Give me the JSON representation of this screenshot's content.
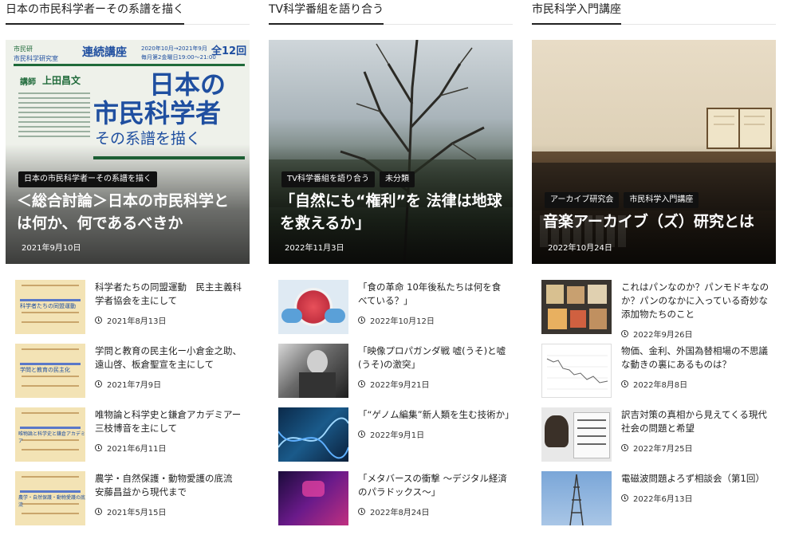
{
  "columns": [
    {
      "section_title": "日本の市民科学者ーその系譜を描く",
      "feature": {
        "tags": [
          "日本の市民科学者ーその系譜を描く"
        ],
        "title": "＜総合討論＞日本の市民科学とは何か、何であるべきか",
        "date": "2021年9月10日",
        "poster": {
          "org": "市民研",
          "lab": "市民科学研究室",
          "series": "連続講座",
          "period": "2020年10月→2021年9月",
          "total": "全12回",
          "schedule": "毎月第2金曜日19:00〜21:00",
          "lecturer_label": "講師",
          "lecturer": "上田昌文",
          "heading_1": "日本の",
          "heading_2": "市民科学者",
          "heading_3": "その系譜を描く"
        }
      },
      "items": [
        {
          "title": "科学者たちの同盟運動　民主主義科学者協会を主にして",
          "date": "2021年8月13日",
          "thumb_label": "科学者たちの同盟運動"
        },
        {
          "title": "学問と教育の民主化ー小倉金之助、遠山啓、板倉聖宣を主にして",
          "date": "2021年7月9日",
          "thumb_label": "学問と教育の民主化"
        },
        {
          "title": "唯物論と科学史と鎌倉アカデミアー三枝博音を主にして",
          "date": "2021年6月11日",
          "thumb_label": "唯物論と科学史と鎌倉アカデミア"
        },
        {
          "title": "農学・自然保護・動物愛護の底流　安藤昌益から現代まで",
          "date": "2021年5月15日",
          "thumb_label": "農学・自然保護・動物愛護の底流"
        }
      ]
    },
    {
      "section_title": "TV科学番組を語り合う",
      "feature": {
        "tags": [
          "TV科学番組を語り合う",
          "未分類"
        ],
        "title": "「自然にも“権利”を 法律は地球を救えるか」",
        "date": "2022年11月3日"
      },
      "items": [
        {
          "title": "「食の革命 10年後私たちは何を食べている？」",
          "date": "2022年10月12日"
        },
        {
          "title": "「映像プロパガンダ戦 嘘(うそ)と嘘(うそ)の激突」",
          "date": "2022年9月21日"
        },
        {
          "title": "「“ゲノム編集”新人類を生む技術か」",
          "date": "2022年9月1日"
        },
        {
          "title": "「メタバースの衝撃 〜デジタル経済のパラドックス〜」",
          "date": "2022年8月24日"
        }
      ]
    },
    {
      "section_title": "市民科学入門講座",
      "feature": {
        "tags": [
          "アーカイブ研究会",
          "市民科学入門講座"
        ],
        "title": "音楽アーカイブ（ズ）研究とは",
        "date": "2022年10月24日"
      },
      "items": [
        {
          "title": "これはパンなのか？パンモドキなのか？パンのなかに入っている奇妙な添加物たちのこと",
          "date": "2022年9月26日"
        },
        {
          "title": "物価、金利、外国為替相場の不思議な動きの裏にあるものは？",
          "date": "2022年8月8日"
        },
        {
          "title": "訳吉対策の真相から見えてくる現代社会の問題と希望",
          "date": "2022年7月25日"
        },
        {
          "title": "電磁波問題よろず相談会（第1回）",
          "date": "2022年6月13日"
        }
      ]
    }
  ],
  "colors": {
    "tag_bg": "#111111",
    "poster_green": "#1f6a3a",
    "poster_blue": "#1f4fa0"
  }
}
